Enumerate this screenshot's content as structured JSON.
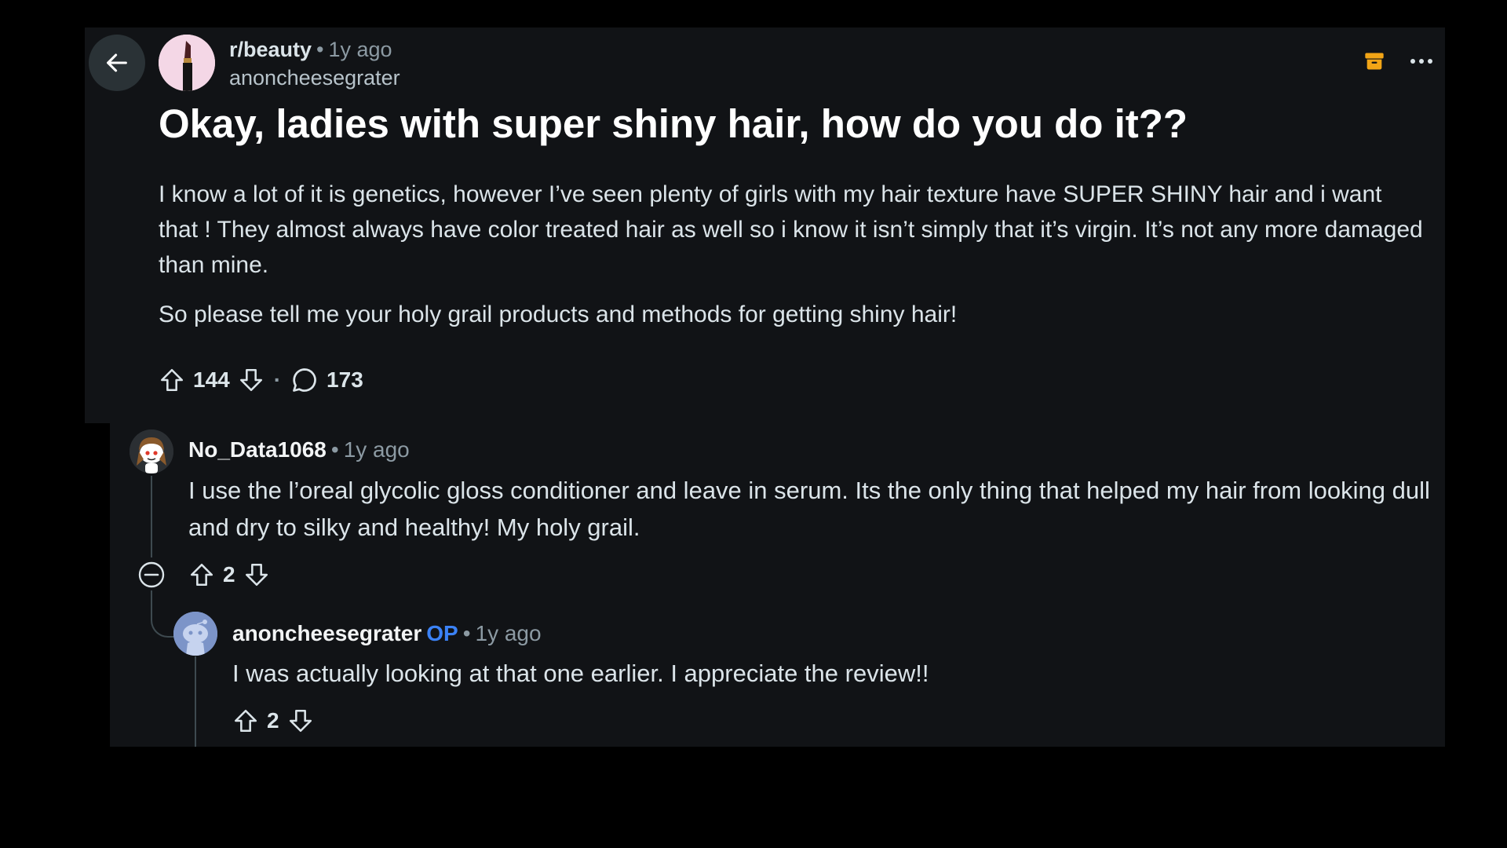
{
  "post": {
    "subreddit": "r/beauty",
    "time": "1y ago",
    "author": "anoncheesegrater",
    "title": "Okay, ladies with super shiny hair, how do you do it??",
    "body": [
      "I know a lot of it is genetics, however I’ve seen plenty of girls with my hair texture have SUPER SHINY hair and i want that ! They almost always have color treated hair as well so i know it isn’t simply that it’s virgin. It’s not any more damaged than mine.",
      "So please tell me your holy grail products and methods for getting shiny hair!"
    ],
    "upvotes": "144",
    "comments": "173"
  },
  "comments": [
    {
      "username": "No_Data1068",
      "time": "1y ago",
      "body": "I use the l’oreal glycolic gloss conditioner and leave in serum. Its the only thing that helped my hair from looking dull and dry to silky and healthy! My holy grail.",
      "votes": "2"
    },
    {
      "username": "anoncheesegrater",
      "op_tag": "OP",
      "time": "1y ago",
      "body": "I was actually looking at that one earlier. I appreciate the review!!",
      "votes": "2"
    }
  ],
  "icons": {
    "back": "arrow-left-icon",
    "archive": "archive-icon",
    "more": "more-horizontal-icon",
    "upvote": "upvote-arrow-icon",
    "downvote": "downvote-arrow-icon",
    "comment": "comment-bubble-icon",
    "collapse": "collapse-minus-icon"
  },
  "colors": {
    "background": "#000000",
    "card": "#111316",
    "archive_accent": "#f2a516",
    "op_tag": "#3b82f6"
  }
}
